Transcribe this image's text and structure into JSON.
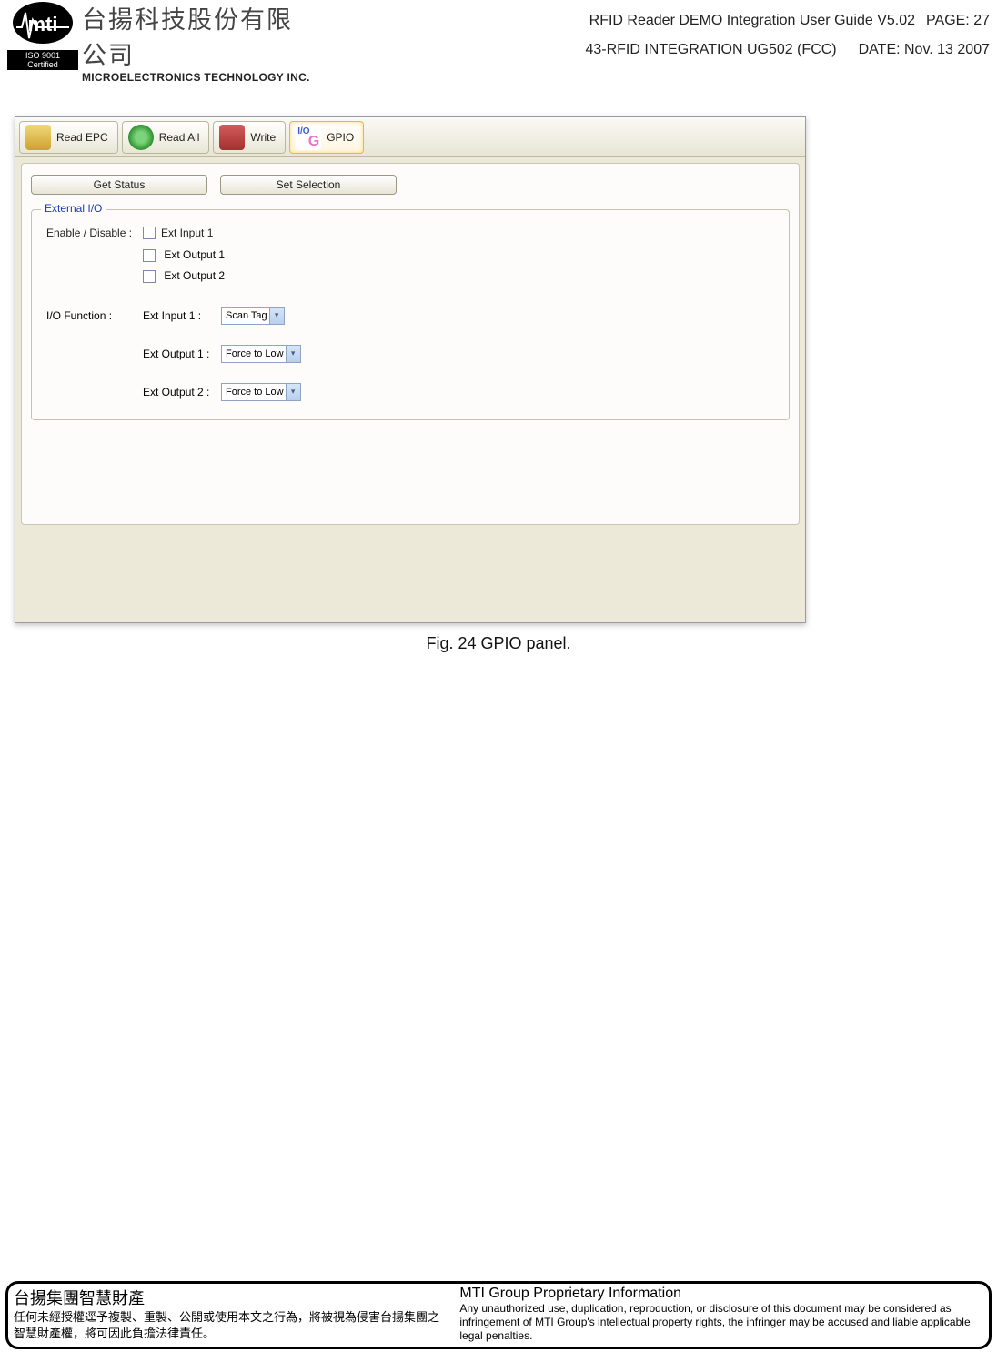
{
  "logo": {
    "iso": "ISO 9001 Certified"
  },
  "company": {
    "cn": "台揚科技股份有限公司",
    "en": "MICROELECTRONICS TECHNOLOGY INC."
  },
  "header": {
    "title": "RFID Reader DEMO Integration User Guide V5.02",
    "page": "PAGE: 27",
    "docid": "43-RFID INTEGRATION UG502 (FCC)",
    "date": "DATE: Nov. 13 2007"
  },
  "toolbar": {
    "read_epc": "Read EPC",
    "read_all": "Read All",
    "write": "Write",
    "gpio": "GPIO"
  },
  "panel": {
    "get_status": "Get Status",
    "set_selection": "Set Selection",
    "groupbox_title": "External I/O",
    "enable_disable": "Enable / Disable :",
    "ext_input1": "Ext Input 1",
    "ext_output1": "Ext Output 1",
    "ext_output2": "Ext Output 2",
    "io_function": "I/O Function :",
    "funcs": {
      "ext_input1_label": "Ext Input 1 :",
      "ext_input1_value": "Scan Tag",
      "ext_output1_label": "Ext Output 1 :",
      "ext_output1_value": "Force to Low",
      "ext_output2_label": "Ext Output 2 :",
      "ext_output2_value": "Force to Low"
    }
  },
  "caption": "Fig. 24    GPIO panel.",
  "footer": {
    "cn_title": "台揚集團智慧財產",
    "cn_body": "任何未經授權逕予複製、重製、公開或使用本文之行為，將被視為侵害台揚集團之智慧財產權，將可因此負擔法律責任。",
    "en_title": "MTI Group Proprietary Information",
    "en_body": "Any unauthorized use, duplication, reproduction, or disclosure of this document may be considered as infringement of MTI Group's intellectual property rights, the infringer may be accused and liable applicable legal penalties."
  }
}
